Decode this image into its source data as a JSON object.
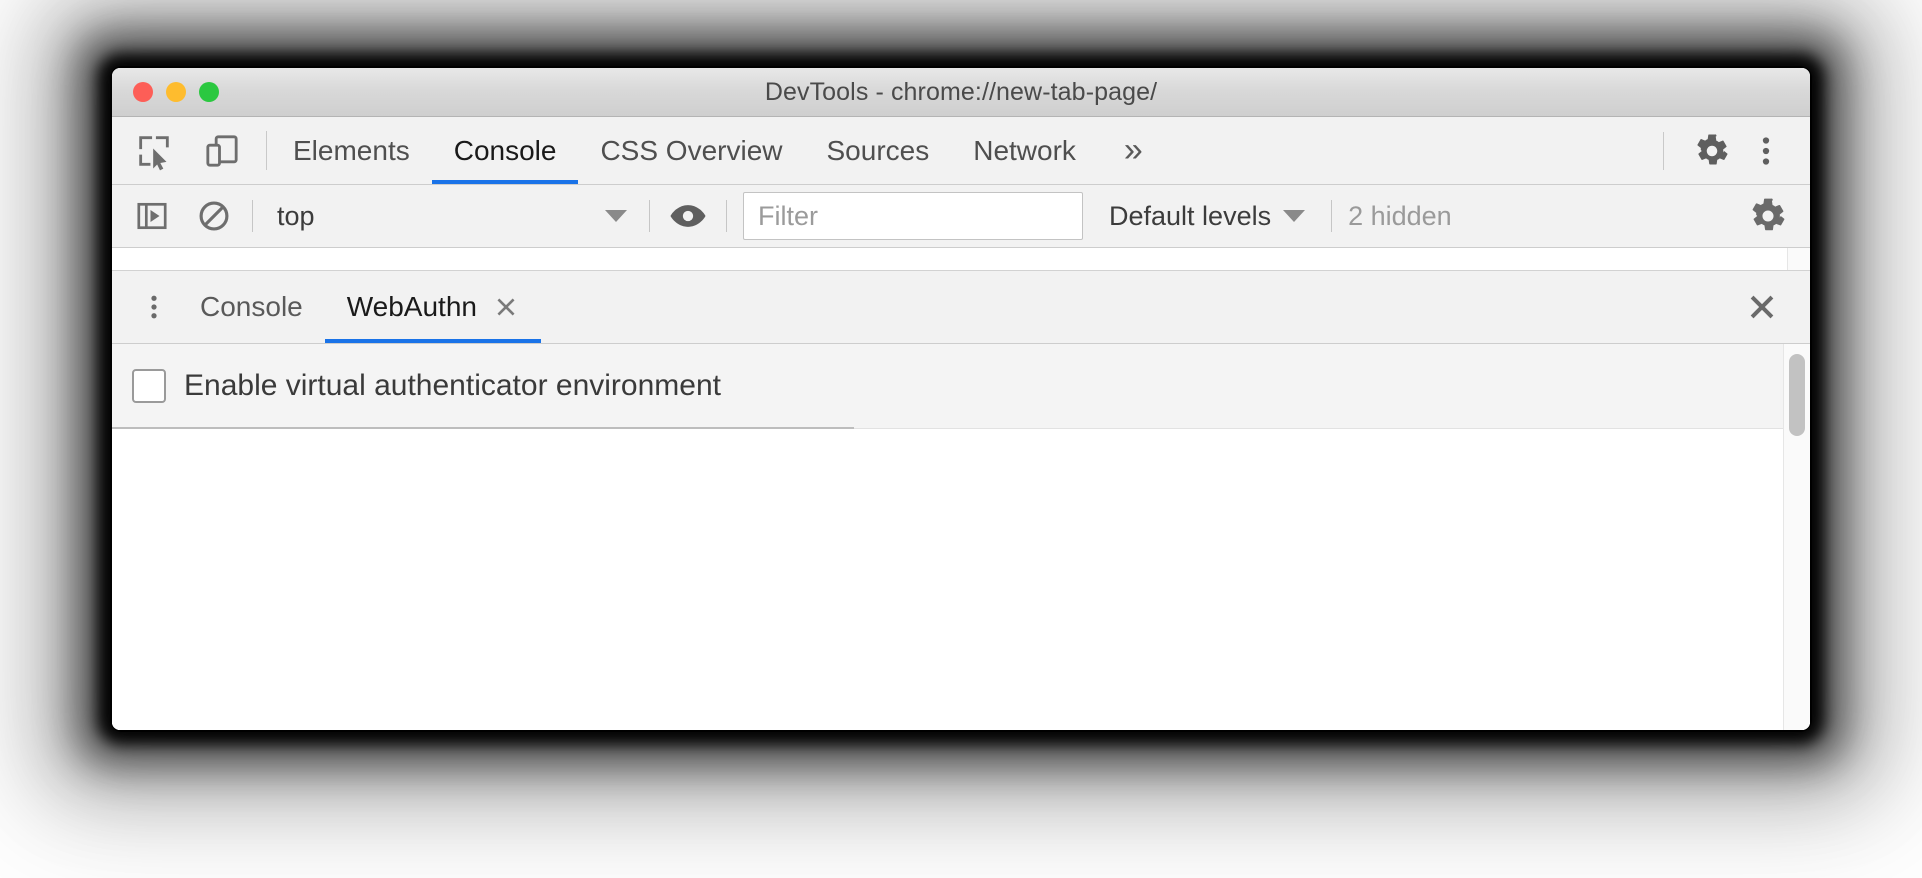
{
  "window": {
    "title": "DevTools - chrome://new-tab-page/",
    "traffic_lights": [
      {
        "name": "close",
        "color": "#fd5e57"
      },
      {
        "name": "minimize",
        "color": "#febc2e"
      },
      {
        "name": "zoom",
        "color": "#2bc840"
      }
    ]
  },
  "accent_color": "#1a73e8",
  "main_toolbar": {
    "inspect_icon": "inspect-element-icon",
    "device_icon": "device-toolbar-icon",
    "tabs": [
      {
        "label": "Elements",
        "active": false
      },
      {
        "label": "Console",
        "active": true
      },
      {
        "label": "CSS Overview",
        "active": false
      },
      {
        "label": "Sources",
        "active": false
      },
      {
        "label": "Network",
        "active": false
      }
    ],
    "overflow_label": "»",
    "settings_icon": "gear-icon",
    "more_icon": "three-dots-vertical-icon"
  },
  "console_toolbar": {
    "sidebar_toggle_icon": "console-sidebar-toggle-icon",
    "clear_icon": "clear-console-icon",
    "context": {
      "value": "top",
      "caret": "chevron-down-icon"
    },
    "live_expression_icon": "eye-icon",
    "filter": {
      "value": "",
      "placeholder": "Filter"
    },
    "levels": {
      "label": "Default levels",
      "caret": "chevron-down-icon"
    },
    "hidden_count": "2 hidden",
    "settings_icon": "gear-icon"
  },
  "drawer": {
    "more_icon": "three-dots-vertical-icon",
    "tabs": [
      {
        "label": "Console",
        "active": false,
        "closable": false
      },
      {
        "label": "WebAuthn",
        "active": true,
        "closable": true,
        "close_icon": "close-icon"
      }
    ],
    "close_icon": "close-icon",
    "webauthn": {
      "enable_checkbox_label": "Enable virtual authenticator environment",
      "enable_checkbox_checked": false
    },
    "scrollbar": {
      "name": "vertical-scrollbar"
    }
  }
}
